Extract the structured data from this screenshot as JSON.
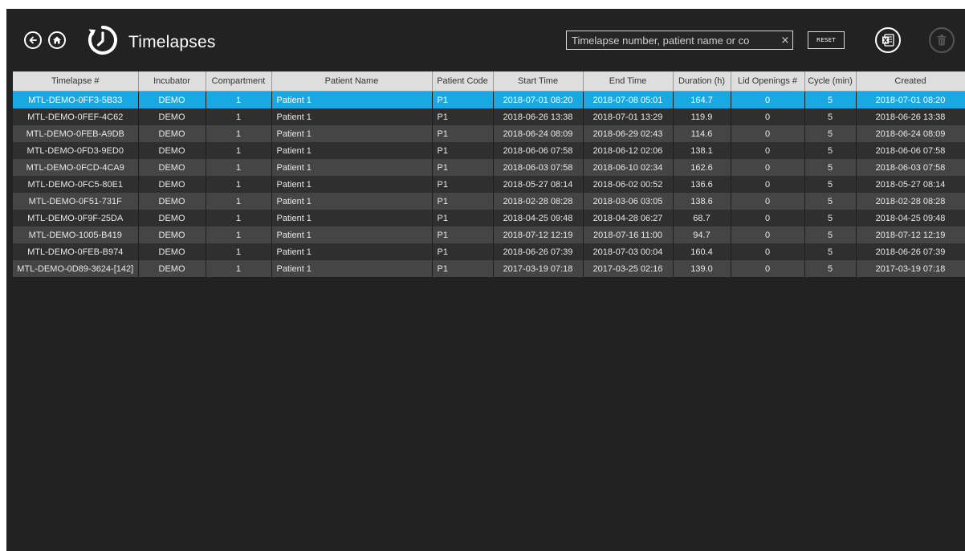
{
  "header": {
    "title": "Timelapses",
    "search_placeholder": "Timelapse number, patient name or co",
    "clear_glyph": "×",
    "reset_label": "RESET",
    "icons": [
      "back-arrow-icon",
      "home-icon",
      "timelapse-clock-icon",
      "excel-export-icon",
      "trash-icon"
    ]
  },
  "table": {
    "columns": [
      "Timelapse #",
      "Incubator",
      "Compartment",
      "Patient Name",
      "Patient Code",
      "Start Time",
      "End Time",
      "Duration (h)",
      "Lid Openings #",
      "Cycle (min)",
      "Created"
    ],
    "selected_row": 0,
    "rows": [
      [
        "MTL-DEMO-0FF3-5B33",
        "DEMO",
        "1",
        "Patient 1",
        "P1",
        "2018-07-01 08:20",
        "2018-07-08 05:01",
        "164.7",
        "0",
        "5",
        "2018-07-01 08:20"
      ],
      [
        "MTL-DEMO-0FEF-4C62",
        "DEMO",
        "1",
        "Patient 1",
        "P1",
        "2018-06-26 13:38",
        "2018-07-01 13:29",
        "119.9",
        "0",
        "5",
        "2018-06-26 13:38"
      ],
      [
        "MTL-DEMO-0FEB-A9DB",
        "DEMO",
        "1",
        "Patient 1",
        "P1",
        "2018-06-24 08:09",
        "2018-06-29 02:43",
        "114.6",
        "0",
        "5",
        "2018-06-24 08:09"
      ],
      [
        "MTL-DEMO-0FD3-9ED0",
        "DEMO",
        "1",
        "Patient 1",
        "P1",
        "2018-06-06 07:58",
        "2018-06-12 02:06",
        "138.1",
        "0",
        "5",
        "2018-06-06 07:58"
      ],
      [
        "MTL-DEMO-0FCD-4CA9",
        "DEMO",
        "1",
        "Patient 1",
        "P1",
        "2018-06-03 07:58",
        "2018-06-10 02:34",
        "162.6",
        "0",
        "5",
        "2018-06-03 07:58"
      ],
      [
        "MTL-DEMO-0FC5-80E1",
        "DEMO",
        "1",
        "Patient 1",
        "P1",
        "2018-05-27 08:14",
        "2018-06-02 00:52",
        "136.6",
        "0",
        "5",
        "2018-05-27 08:14"
      ],
      [
        "MTL-DEMO-0F51-731F",
        "DEMO",
        "1",
        "Patient 1",
        "P1",
        "2018-02-28 08:28",
        "2018-03-06 03:05",
        "138.6",
        "0",
        "5",
        "2018-02-28 08:28"
      ],
      [
        "MTL-DEMO-0F9F-25DA",
        "DEMO",
        "1",
        "Patient 1",
        "P1",
        "2018-04-25 09:48",
        "2018-04-28 06:27",
        "68.7",
        "0",
        "5",
        "2018-04-25 09:48"
      ],
      [
        "MTL-DEMO-1005-B419",
        "DEMO",
        "1",
        "Patient 1",
        "P1",
        "2018-07-12 12:19",
        "2018-07-16 11:00",
        "94.7",
        "0",
        "5",
        "2018-07-12 12:19"
      ],
      [
        "MTL-DEMO-0FEB-B974",
        "DEMO",
        "1",
        "Patient 1",
        "P1",
        "2018-06-26 07:39",
        "2018-07-03 00:04",
        "160.4",
        "0",
        "5",
        "2018-06-26 07:39"
      ],
      [
        "MTL-DEMO-0D89-3624-[142]",
        "DEMO",
        "1",
        "Patient 1",
        "P1",
        "2017-03-19 07:18",
        "2017-03-25 02:16",
        "139.0",
        "0",
        "5",
        "2017-03-19 07:18"
      ]
    ]
  },
  "colors": {
    "background": "#222222",
    "selected_row": "#1aa8e2",
    "header_row": "#dedede",
    "row_dark": "#2f2f2f",
    "row_light": "#454545"
  }
}
